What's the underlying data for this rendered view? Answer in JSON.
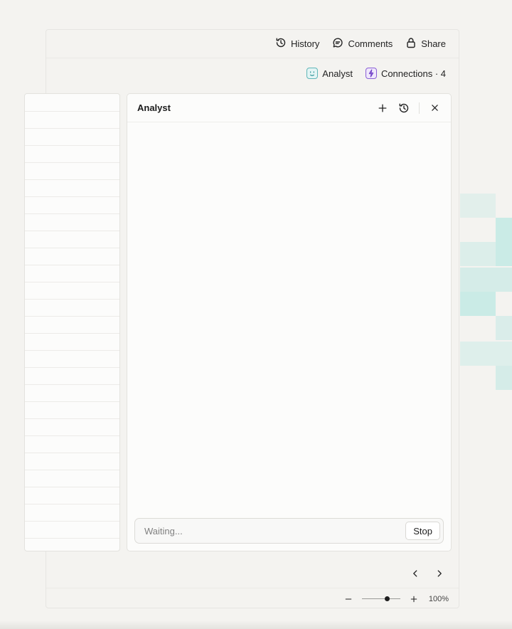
{
  "toolbar": {
    "history_label": "History",
    "comments_label": "Comments",
    "share_label": "Share"
  },
  "secondary_toolbar": {
    "analyst_label": "Analyst",
    "connections_label": "Connections · 4"
  },
  "analyst_panel": {
    "title": "Analyst",
    "input_placeholder": "Waiting...",
    "stop_label": "Stop"
  },
  "zoom": {
    "level_label": "100%",
    "level": 0.66
  },
  "colors": {
    "accent_teal": "#5fb6b8",
    "accent_purple": "#8a5fd6"
  }
}
